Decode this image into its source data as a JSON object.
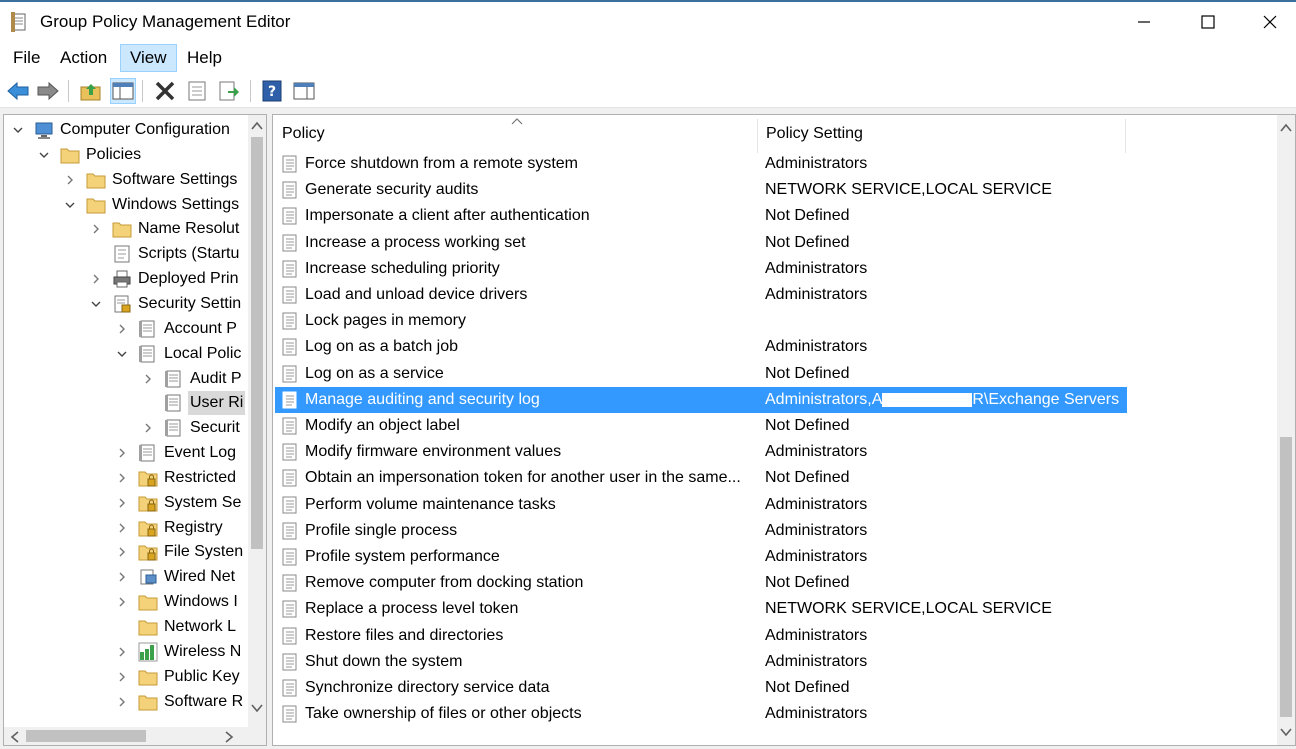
{
  "window": {
    "title": "Group Policy Management Editor"
  },
  "menu": [
    "File",
    "Action",
    "View",
    "Help"
  ],
  "tree": [
    {
      "label": "Computer Configuration",
      "level": 0,
      "toggle": "open",
      "icon": "computer"
    },
    {
      "label": "Policies",
      "level": 1,
      "toggle": "open",
      "icon": "folder"
    },
    {
      "label": "Software Settings",
      "level": 2,
      "toggle": "closed",
      "icon": "folder"
    },
    {
      "label": "Windows Settings",
      "level": 2,
      "toggle": "open",
      "icon": "folder"
    },
    {
      "label": "Name Resolut",
      "level": 3,
      "toggle": "closed",
      "icon": "folder"
    },
    {
      "label": "Scripts (Startu",
      "level": 3,
      "toggle": "none",
      "icon": "script"
    },
    {
      "label": "Deployed Prin",
      "level": 3,
      "toggle": "closed",
      "icon": "printer"
    },
    {
      "label": "Security Settin",
      "level": 3,
      "toggle": "open",
      "icon": "security"
    },
    {
      "label": "Account P",
      "level": 4,
      "toggle": "closed",
      "icon": "policy"
    },
    {
      "label": "Local Polic",
      "level": 4,
      "toggle": "open",
      "icon": "policy"
    },
    {
      "label": "Audit P",
      "level": 5,
      "toggle": "closed",
      "icon": "policy"
    },
    {
      "label": "User Ri",
      "level": 5,
      "toggle": "none",
      "icon": "policy",
      "selected": true
    },
    {
      "label": "Securit",
      "level": 5,
      "toggle": "closed",
      "icon": "policy"
    },
    {
      "label": "Event Log",
      "level": 4,
      "toggle": "closed",
      "icon": "policy"
    },
    {
      "label": "Restricted",
      "level": 4,
      "toggle": "closed",
      "icon": "lockfolder"
    },
    {
      "label": "System Se",
      "level": 4,
      "toggle": "closed",
      "icon": "lockfolder"
    },
    {
      "label": "Registry",
      "level": 4,
      "toggle": "closed",
      "icon": "lockfolder"
    },
    {
      "label": "File Systen",
      "level": 4,
      "toggle": "closed",
      "icon": "lockfolder"
    },
    {
      "label": "Wired Net",
      "level": 4,
      "toggle": "closed",
      "icon": "network"
    },
    {
      "label": "Windows I",
      "level": 4,
      "toggle": "closed",
      "icon": "folder"
    },
    {
      "label": "Network L",
      "level": 4,
      "toggle": "none",
      "icon": "folder"
    },
    {
      "label": "Wireless N",
      "level": 4,
      "toggle": "closed",
      "icon": "wireless"
    },
    {
      "label": "Public Key",
      "level": 4,
      "toggle": "closed",
      "icon": "folder"
    },
    {
      "label": "Software R",
      "level": 4,
      "toggle": "closed",
      "icon": "folder"
    }
  ],
  "list": {
    "columns": [
      "Policy",
      "Policy Setting"
    ],
    "rows": [
      {
        "policy": "Force shutdown from a remote system",
        "setting": "Administrators"
      },
      {
        "policy": "Generate security audits",
        "setting": "NETWORK SERVICE,LOCAL SERVICE"
      },
      {
        "policy": "Impersonate a client after authentication",
        "setting": "Not Defined"
      },
      {
        "policy": "Increase a process working set",
        "setting": "Not Defined"
      },
      {
        "policy": "Increase scheduling priority",
        "setting": "Administrators"
      },
      {
        "policy": "Load and unload device drivers",
        "setting": "Administrators"
      },
      {
        "policy": "Lock pages in memory",
        "setting": ""
      },
      {
        "policy": "Log on as a batch job",
        "setting": "Administrators"
      },
      {
        "policy": "Log on as a service",
        "setting": "Not Defined"
      },
      {
        "policy": "Manage auditing and security log",
        "setting": "Administrators,A",
        "setting_suffix": "R\\Exchange Servers",
        "selected": true
      },
      {
        "policy": "Modify an object label",
        "setting": "Not Defined"
      },
      {
        "policy": "Modify firmware environment values",
        "setting": "Administrators"
      },
      {
        "policy": "Obtain an impersonation token for another user in the same...",
        "setting": "Not Defined"
      },
      {
        "policy": "Perform volume maintenance tasks",
        "setting": "Administrators"
      },
      {
        "policy": "Profile single process",
        "setting": "Administrators"
      },
      {
        "policy": "Profile system performance",
        "setting": "Administrators"
      },
      {
        "policy": "Remove computer from docking station",
        "setting": "Not Defined"
      },
      {
        "policy": "Replace a process level token",
        "setting": "NETWORK SERVICE,LOCAL SERVICE"
      },
      {
        "policy": "Restore files and directories",
        "setting": "Administrators"
      },
      {
        "policy": "Shut down the system",
        "setting": "Administrators"
      },
      {
        "policy": "Synchronize directory service data",
        "setting": "Not Defined"
      },
      {
        "policy": "Take ownership of files or other objects",
        "setting": "Administrators"
      }
    ]
  },
  "colors": {
    "selection": "#3399ff",
    "menu_highlight": "#cce8ff",
    "title_accent": "#3a6f9e"
  }
}
